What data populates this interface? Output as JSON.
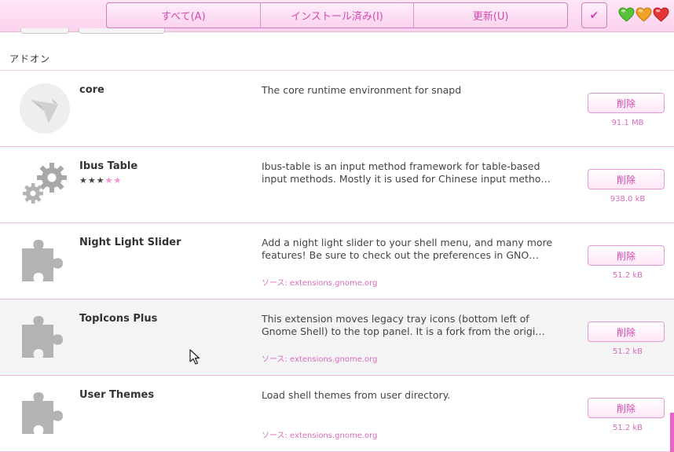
{
  "header": {
    "tabs": [
      "すべて(A)",
      "インストール済み(I)",
      "更新(U)"
    ],
    "check_icon": "checkmark-icon",
    "window_controls": [
      {
        "name": "minimize-heart-icon",
        "color": "#58c23a"
      },
      {
        "name": "maximize-heart-icon",
        "color": "#f0a227"
      },
      {
        "name": "close-heart-icon",
        "color": "#e43537"
      }
    ]
  },
  "section_title": "アドオン",
  "addons": [
    {
      "name": "core",
      "description": [
        "The core runtime environment for snapd"
      ],
      "source": "",
      "button": "削除",
      "size": "91.1 MB",
      "icon": "snapd-bird-icon",
      "stars": null
    },
    {
      "name": "Ibus Table",
      "description": [
        "Ibus-table is an input method framework for table-based",
        "input methods.  Mostly it is used for Chinese input metho…"
      ],
      "source": "",
      "button": "削除",
      "size": "938.0 kB",
      "icon": "gears-icon",
      "stars": {
        "filled": "★★★",
        "empty": "★★"
      }
    },
    {
      "name": "Night Light Slider",
      "description": [
        "Add a night light slider to your shell menu, and many more",
        "features!  Be sure to check out the preferences in GNO…"
      ],
      "source": "ソース: extensions.gnome.org",
      "button": "削除",
      "size": "51.2 kB",
      "icon": "puzzle-icon",
      "stars": null
    },
    {
      "name": "TopIcons Plus",
      "description": [
        "This extension moves legacy tray icons (bottom left of",
        "Gnome Shell) to the top panel. It is a fork from the origi…"
      ],
      "source": "ソース: extensions.gnome.org",
      "button": "削除",
      "size": "51.2 kB",
      "icon": "puzzle-icon",
      "stars": null
    },
    {
      "name": "User Themes",
      "description": [
        "Load shell themes from user directory."
      ],
      "source": "ソース: extensions.gnome.org",
      "button": "削除",
      "size": "51.2 kB",
      "icon": "puzzle-icon",
      "stars": null
    }
  ],
  "colors": {
    "accent": "#d14ab0",
    "star_filled": "#444444",
    "star_empty": "#f58ad6",
    "icon_gray": "#b3b3b3"
  }
}
